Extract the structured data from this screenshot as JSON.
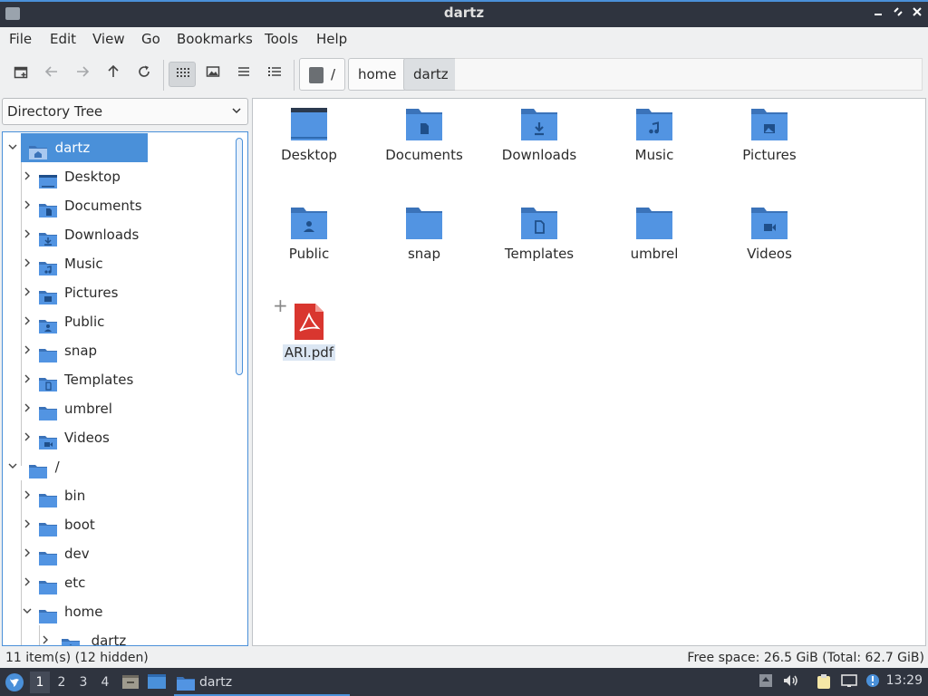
{
  "window": {
    "title": "dartz"
  },
  "menu": [
    "File",
    "Edit",
    "View",
    "Go",
    "Bookmarks",
    "Tools",
    "Help"
  ],
  "path": {
    "root": "/",
    "crumbs": [
      "home",
      "dartz"
    ]
  },
  "side_pane": {
    "mode": "Directory Tree"
  },
  "tree": {
    "home_node": "dartz",
    "home_children": [
      "Desktop",
      "Documents",
      "Downloads",
      "Music",
      "Pictures",
      "Public",
      "snap",
      "Templates",
      "umbrel",
      "Videos"
    ],
    "root_node": "/",
    "root_children": [
      "bin",
      "boot",
      "dev",
      "etc",
      "home"
    ],
    "home_sub": "dartz"
  },
  "files": [
    {
      "name": "Desktop",
      "icon": "desktop-folder"
    },
    {
      "name": "Documents",
      "icon": "documents-folder"
    },
    {
      "name": "Downloads",
      "icon": "downloads-folder"
    },
    {
      "name": "Music",
      "icon": "music-folder"
    },
    {
      "name": "Pictures",
      "icon": "pictures-folder"
    },
    {
      "name": "Public",
      "icon": "public-folder"
    },
    {
      "name": "snap",
      "icon": "folder"
    },
    {
      "name": "Templates",
      "icon": "templates-folder"
    },
    {
      "name": "umbrel",
      "icon": "folder"
    },
    {
      "name": "Videos",
      "icon": "videos-folder"
    },
    {
      "name": "ARI.pdf",
      "icon": "pdf-file"
    }
  ],
  "status": {
    "items": "11 item(s) (12 hidden)",
    "free_space": "Free space: 26.5 GiB (Total: 62.7 GiB)"
  },
  "taskbar": {
    "workspaces": [
      "1",
      "2",
      "3",
      "4"
    ],
    "task_title": "dartz",
    "clock": "13:29"
  },
  "colors": {
    "accent": "#4a90d9",
    "folder": "#5294e2",
    "folder_dark": "#3b73b9",
    "pdf": "#d9362f",
    "panel": "#2f343f"
  }
}
